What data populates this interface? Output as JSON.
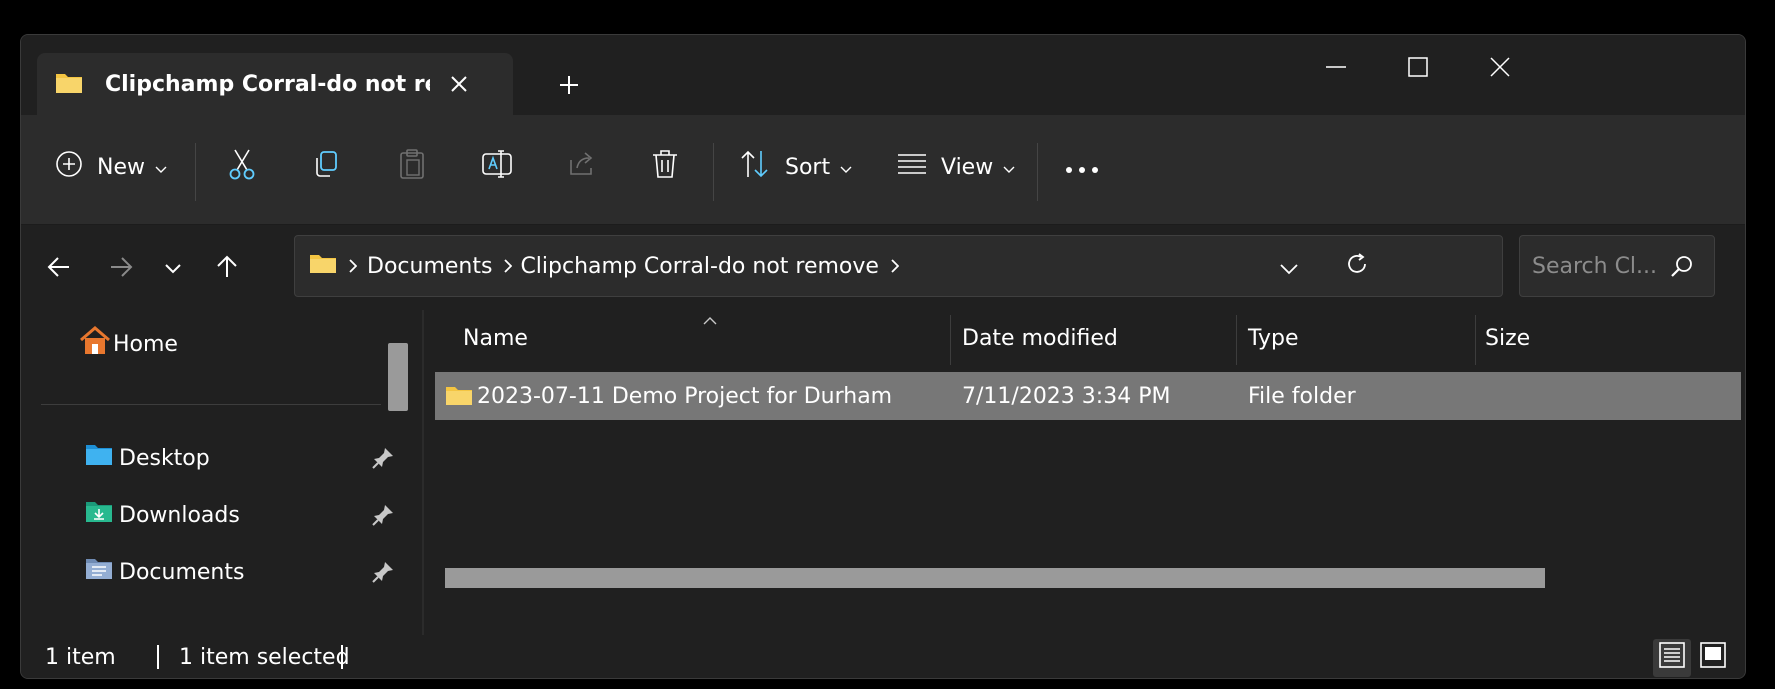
{
  "tab": {
    "title": "Clipchamp Corral-do not remove"
  },
  "toolbar": {
    "new_label": "New",
    "sort_label": "Sort",
    "view_label": "View"
  },
  "address": {
    "crumbs": [
      "Documents",
      "Clipchamp Corral-do not remove"
    ]
  },
  "search": {
    "placeholder": "Search Cl..."
  },
  "nav": {
    "home": "Home",
    "items": [
      {
        "label": "Desktop",
        "icon": "desktop-icon"
      },
      {
        "label": "Downloads",
        "icon": "downloads-icon"
      },
      {
        "label": "Documents",
        "icon": "documents-icon"
      }
    ]
  },
  "columns": {
    "name": "Name",
    "date": "Date modified",
    "type": "Type",
    "size": "Size"
  },
  "files": [
    {
      "name": "2023-07-11 Demo Project for Durham",
      "date": "7/11/2023 3:34 PM",
      "type": "File folder",
      "size": ""
    }
  ],
  "status": {
    "count": "1 item",
    "selected": "1 item selected"
  },
  "colors": {
    "accent": "#60cdff",
    "folder": "#f4c542",
    "selection": "#777777"
  }
}
